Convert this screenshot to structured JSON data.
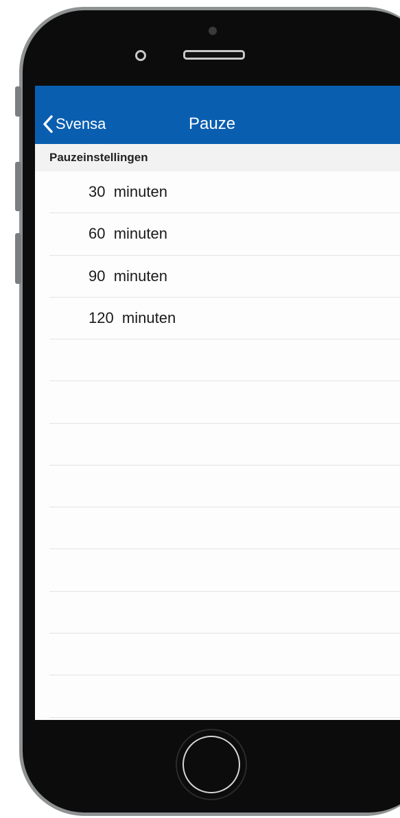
{
  "navigation": {
    "back_label": "Svensa",
    "title": "Pauze"
  },
  "section": {
    "header": "Pauzeinstellingen"
  },
  "options": [
    {
      "label": "30  minuten"
    },
    {
      "label": "60  minuten"
    },
    {
      "label": "90  minuten"
    },
    {
      "label": "120  minuten"
    }
  ],
  "colors": {
    "nav_bar": "#0a5eb0",
    "section_header_bg": "#f2f2f2",
    "screen_bg": "#fdfdfd",
    "phone_frame": "#8f9293",
    "phone_body": "#0c0c0c"
  },
  "icons": {
    "back": "chevron-left-icon"
  }
}
